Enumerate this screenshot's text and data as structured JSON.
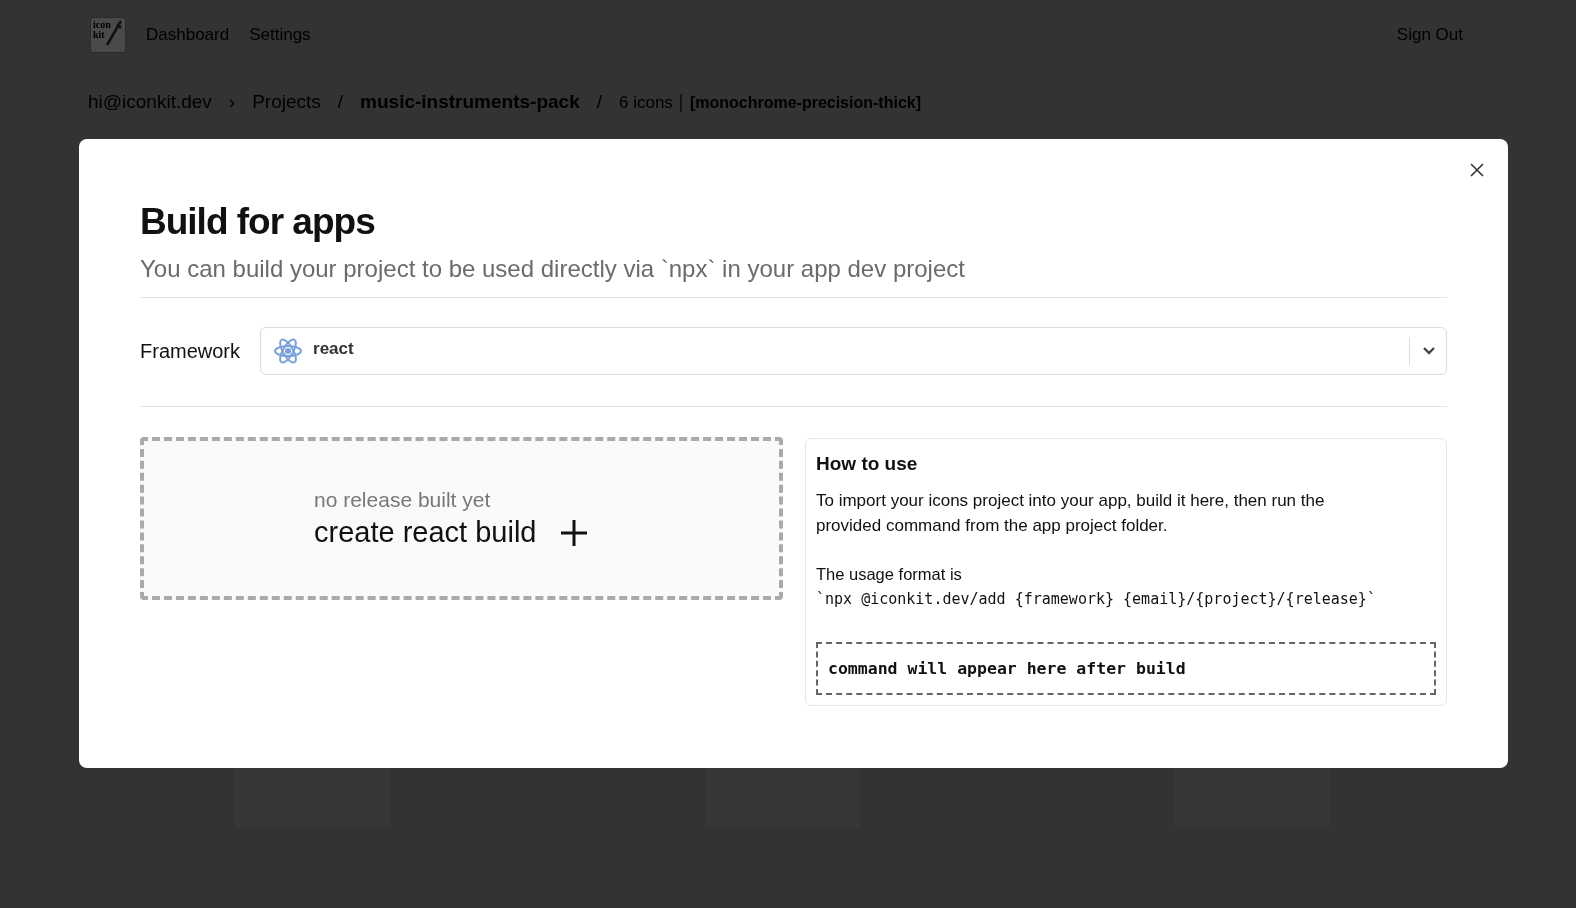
{
  "logo": {
    "lines": [
      "icon",
      "kit"
    ]
  },
  "nav": {
    "links": [
      {
        "label": "Dashboard"
      },
      {
        "label": "Settings"
      }
    ],
    "sign_out": "Sign Out"
  },
  "breadcrumb": {
    "account": "hi@iconkit.dev",
    "separator_1": "›",
    "projects": "Projects",
    "separator_2": "/",
    "project": "music-instruments-pack",
    "separator_3": "/",
    "count": "6 icons",
    "style": "[monochrome-precision-thick]"
  },
  "dialog": {
    "title": "Build for apps",
    "subtitle": "You can build your project to be used directly via `npx` in your app dev project",
    "framework": {
      "label": "Framework",
      "value": "react"
    },
    "build": {
      "status": "no release built yet",
      "action": "create react build"
    },
    "help": {
      "title": "How to use",
      "text": "To import your icons project into your app, build it here, then run the provided command from the app project folder.",
      "format_label": "The usage format is",
      "format": "`npx @iconkit.dev/add {framework} {email}/{project}/{release}`",
      "command_placeholder": "command will appear here after build"
    }
  }
}
